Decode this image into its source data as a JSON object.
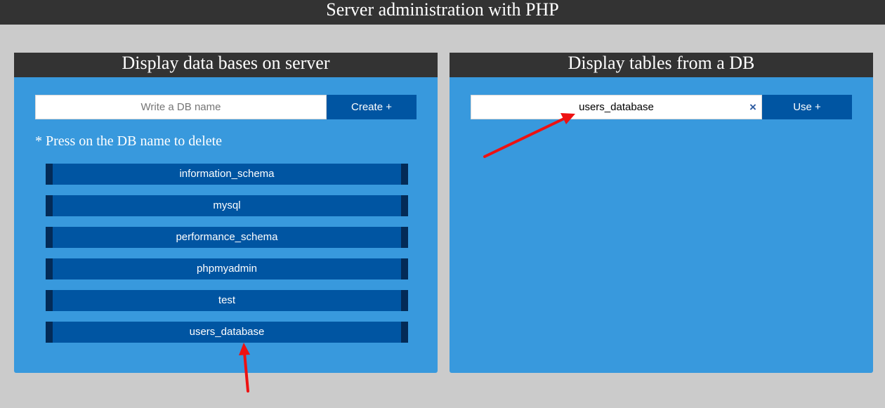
{
  "header": {
    "title": "Server administration with PHP"
  },
  "left_panel": {
    "title": "Display data bases on server",
    "input": {
      "value": "",
      "placeholder": "Write a DB name"
    },
    "create_label": "Create +",
    "hint": "* Press on the DB name to delete",
    "databases": [
      "information_schema",
      "mysql",
      "performance_schema",
      "phpmyadmin",
      "test",
      "users_database"
    ]
  },
  "right_panel": {
    "title": "Display tables from a DB",
    "input": {
      "value": "users_database",
      "placeholder": ""
    },
    "clear_label": "×",
    "use_label": "Use +"
  },
  "colors": {
    "page_bg": "#cbcbcb",
    "header_bg": "#333333",
    "panel_bg": "#3899dd",
    "button_bg": "#0055a2",
    "item_edge": "#032b57",
    "annotation_arrow": "#ee1111",
    "clear_icon": "#2c5aa0"
  },
  "icons": {
    "clear": "close-icon",
    "annotations": [
      "red-arrow-annotation",
      "red-arrow-annotation"
    ]
  }
}
